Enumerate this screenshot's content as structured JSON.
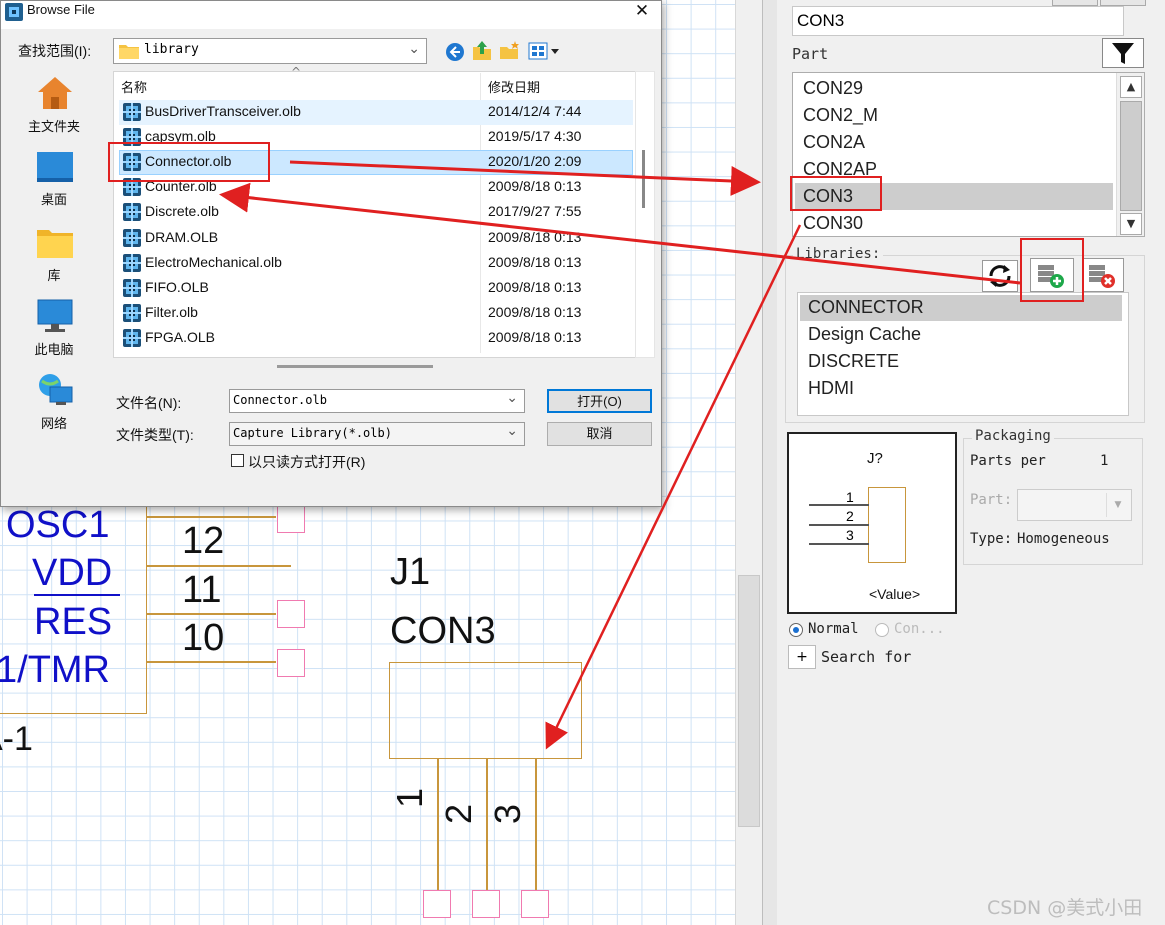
{
  "dialog": {
    "title": "Browse File",
    "close_glyph": "✕",
    "look_in_label": "查找范围(I):",
    "look_in_value": "library",
    "columns": {
      "name": "名称",
      "date": "修改日期"
    },
    "places": [
      {
        "label": "主文件夹",
        "icon": "home-icon"
      },
      {
        "label": "桌面",
        "icon": "desktop-icon"
      },
      {
        "label": "库",
        "icon": "folder-icon"
      },
      {
        "label": "此电脑",
        "icon": "computer-icon"
      },
      {
        "label": "网络",
        "icon": "network-icon"
      }
    ],
    "files": [
      {
        "name": "BusDriverTransceiver.olb",
        "date": "2014/12/4 7:44"
      },
      {
        "name": "capsym.olb",
        "date": "2019/5/17 4:30"
      },
      {
        "name": "Connector.olb",
        "date": "2020/1/20 2:09",
        "selected": true
      },
      {
        "name": "Counter.olb",
        "date": "2009/8/18 0:13"
      },
      {
        "name": "Discrete.olb",
        "date": "2017/9/27 7:55"
      },
      {
        "name": "DRAM.OLB",
        "date": "2009/8/18 0:13"
      },
      {
        "name": "ElectroMechanical.olb",
        "date": "2009/8/18 0:13"
      },
      {
        "name": "FIFO.OLB",
        "date": "2009/8/18 0:13"
      },
      {
        "name": "Filter.olb",
        "date": "2009/8/18 0:13"
      },
      {
        "name": "FPGA.OLB",
        "date": "2009/8/18 0:13"
      }
    ],
    "filename_label": "文件名(N):",
    "filename_value": "Connector.olb",
    "filetype_label": "文件类型(T):",
    "filetype_value": "Capture Library(*.olb)",
    "readonly_label": "以只读方式打开(R)",
    "open_button": "打开(O)",
    "cancel_button": "取消"
  },
  "panel": {
    "search_value": "CON3",
    "part_label": "Part",
    "parts": [
      "CON29",
      "CON2_M",
      "CON2A",
      "CON2AP",
      "CON3",
      "CON30"
    ],
    "selected_part": "CON3",
    "libraries_label": "Libraries:",
    "libraries": [
      "CONNECTOR",
      "Design Cache",
      "DISCRETE",
      "HDMI"
    ],
    "selected_library": "CONNECTOR",
    "preview": {
      "ref": "J?",
      "pins": [
        "1",
        "2",
        "3"
      ],
      "value": "<Value>"
    },
    "packaging": {
      "title": "Packaging",
      "parts_per_label": "Parts per",
      "parts_per_value": "1",
      "part_label": "Part:",
      "type_label": "Type:",
      "type_value": "Homogeneous"
    },
    "normal_label": "Normal",
    "convert_label": "Con...",
    "search_for_label": "Search for",
    "expand_glyph": "+"
  },
  "schematic": {
    "left_labels": [
      "OSC1",
      "VDD",
      "RES",
      "1/TMR"
    ],
    "pin_numbers": [
      "12",
      "11",
      "10"
    ],
    "left_part_suffix": "A-1",
    "part_ref": "J1",
    "part_value": "CON3",
    "part_pins": [
      "1",
      "2",
      "3"
    ]
  },
  "watermark": "CSDN @美式小田",
  "colors": {
    "annotation": "#e02020",
    "selection": "#cce8ff",
    "pin_box": "#f07ab0",
    "part_outline": "#c8963c",
    "net_label": "#1010c8"
  }
}
